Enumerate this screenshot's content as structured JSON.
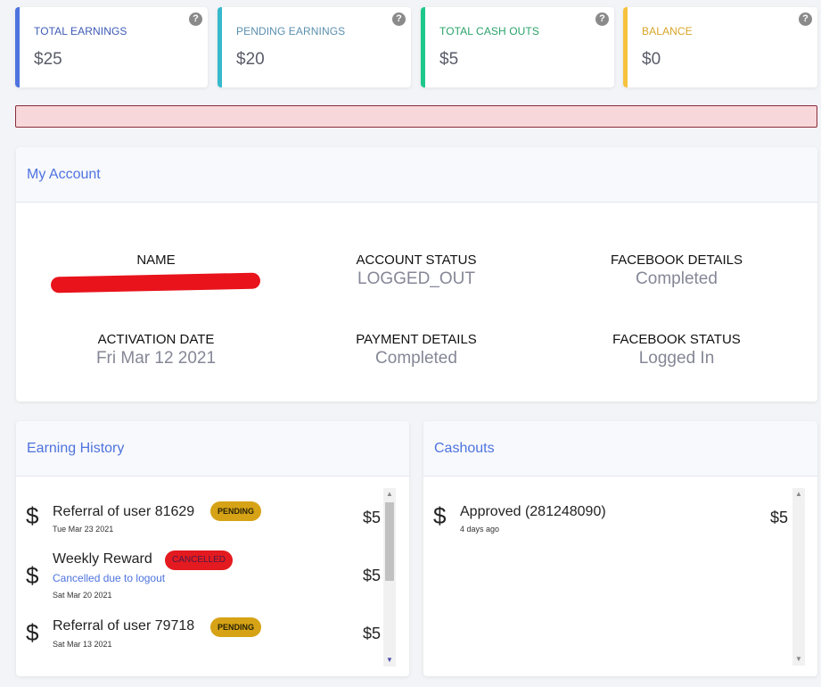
{
  "stats": [
    {
      "label": "TOTAL EARNINGS",
      "value": "$25",
      "color": "#4e73df",
      "label_color": "#3d5bb5"
    },
    {
      "label": "PENDING EARNINGS",
      "value": "$20",
      "color": "#36b9cc",
      "label_color": "#5a8fb0"
    },
    {
      "label": "TOTAL CASH OUTS",
      "value": "$5",
      "color": "#1cc88a",
      "label_color": "#2aa36a"
    },
    {
      "label": "BALANCE",
      "value": "$0",
      "color": "#f6c23e",
      "label_color": "#d9a426"
    }
  ],
  "help_glyph": "?",
  "account": {
    "title": "My Account",
    "fields": [
      {
        "key": "NAME",
        "value": ""
      },
      {
        "key": "ACCOUNT STATUS",
        "value": "LOGGED_OUT"
      },
      {
        "key": "FACEBOOK DETAILS",
        "value": "Completed"
      },
      {
        "key": "ACTIVATION DATE",
        "value": "Fri Mar 12 2021"
      },
      {
        "key": "PAYMENT DETAILS",
        "value": "Completed"
      },
      {
        "key": "FACEBOOK STATUS",
        "value": "Logged In"
      }
    ]
  },
  "earning_history": {
    "title": "Earning History",
    "items": [
      {
        "title": "Referral of user 81629",
        "badge": "PENDING",
        "date": "Tue Mar 23 2021",
        "amount": "$5"
      },
      {
        "title": "Weekly Reward",
        "badge": "CANCELLED",
        "note": "Cancelled due to logout",
        "date": "Sat Mar 20 2021",
        "amount": "$5"
      },
      {
        "title": "Referral of user 79718",
        "badge": "PENDING",
        "date": "Sat Mar 13 2021",
        "amount": "$5"
      }
    ]
  },
  "cashouts": {
    "title": "Cashouts",
    "items": [
      {
        "title": "Approved (281248090)",
        "date": "4 days ago",
        "amount": "$5"
      }
    ]
  },
  "currency_symbol": "$"
}
